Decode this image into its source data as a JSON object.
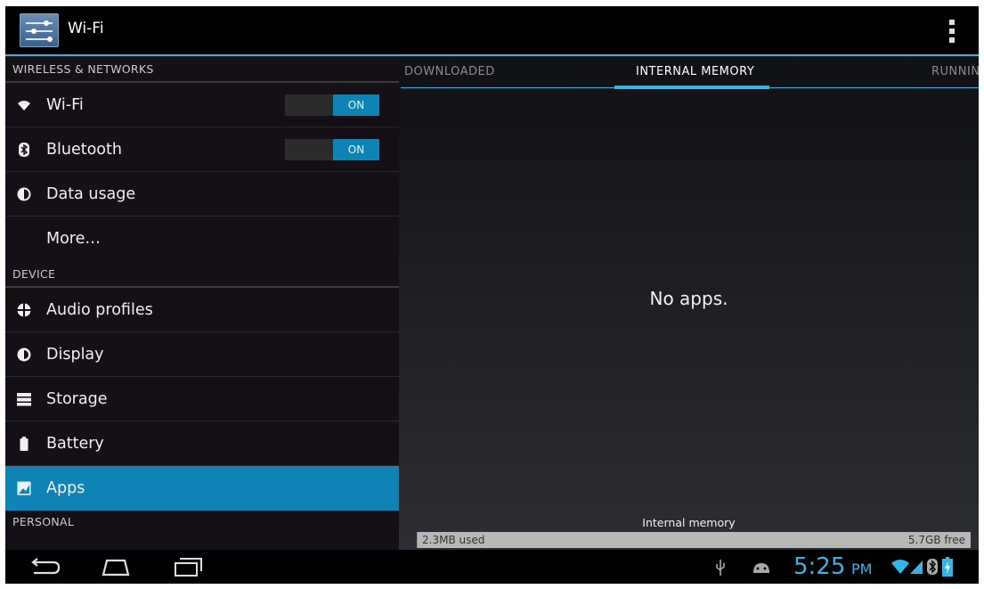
{
  "action_bar": {
    "title": "Wi-Fi",
    "accent_color": "#33b5e5"
  },
  "sidebar": {
    "headers": [
      "WIRELESS & NETWORKS",
      "DEVICE",
      "PERSONAL"
    ],
    "items": [
      {
        "label": "Wi-Fi",
        "icon": "wifi-icon",
        "toggle": "ON"
      },
      {
        "label": "Bluetooth",
        "icon": "bluetooth-icon",
        "toggle": "ON"
      },
      {
        "label": "Data usage",
        "icon": "data-usage-icon"
      },
      {
        "label": "More…"
      },
      {
        "label": "Audio profiles",
        "icon": "audio-profiles-icon"
      },
      {
        "label": "Display",
        "icon": "display-icon"
      },
      {
        "label": "Storage",
        "icon": "storage-icon"
      },
      {
        "label": "Battery",
        "icon": "battery-icon"
      },
      {
        "label": "Apps",
        "icon": "apps-icon",
        "selected": true
      }
    ],
    "selected_color": "#0f84b4"
  },
  "tabs": [
    {
      "label": "DOWNLOADED"
    },
    {
      "label": "INTERNAL MEMORY",
      "active": true
    },
    {
      "label": "RUNNING"
    }
  ],
  "main": {
    "empty_message": "No apps.",
    "memory": {
      "title": "Internal memory",
      "used": "2.3MB used",
      "free": "5.7GB free",
      "used_fraction": 0.0004
    }
  },
  "status": {
    "time": "5:25",
    "ampm": "PM",
    "icons": [
      "usb-icon",
      "android-debug-icon",
      "wifi-signal-icon",
      "cell-signal-icon",
      "bluetooth-status-icon",
      "battery-charging-icon"
    ]
  },
  "nav": {
    "buttons": [
      "back-button",
      "home-button",
      "recent-apps-button"
    ]
  }
}
